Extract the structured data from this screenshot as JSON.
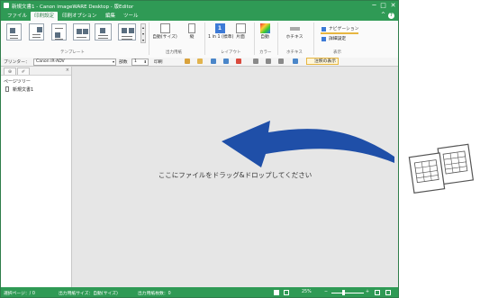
{
  "window": {
    "title": "新規文書1 - Canon imageWARE Desktop - 版Editor",
    "min": "─",
    "max": "□",
    "close": "✕"
  },
  "menubar": {
    "items": [
      {
        "label": "ファイル",
        "active": false
      },
      {
        "label": "印刷設定",
        "active": true
      },
      {
        "label": "印刷オプション",
        "active": false
      },
      {
        "label": "編集",
        "active": false
      },
      {
        "label": "ツール",
        "active": false
      }
    ],
    "help": "?",
    "collapse": "^"
  },
  "ribbon": {
    "groups": {
      "template": "テンプレート",
      "output": "出力用紙",
      "layout": "レイアウト",
      "color": "カラー",
      "stamp": "ホチキス",
      "display": "表示"
    },
    "buttons": {
      "auto_size": "自動(サイズ)",
      "orientation": "縦",
      "n_up": "1 in 1 (標準)",
      "sides": "片面",
      "color": "自動",
      "staple": "ホチキス",
      "navigation": "ナビゲーション",
      "details": "詳細設定"
    }
  },
  "toolbar": {
    "printer_label": "プリンター：",
    "printer_value": "Canon iR-ADV",
    "copies_label": "部数",
    "copies_value": "1",
    "print_label": "印刷",
    "show_options": "注釈の表示"
  },
  "leftpanel": {
    "tabs": [
      "⊕",
      "✐"
    ],
    "close": "×",
    "heading": "ページツリー",
    "document": "新規文書1"
  },
  "work": {
    "drop_hint": "ここにファイルをドラッグ&ドロップしてください"
  },
  "status": {
    "selected_pages": "選択ページ：/ 0",
    "output_size": "出力用紙サイズ：自動(サイズ)",
    "output_count": "出力用紙枚数：0",
    "zoom": "25%",
    "zoom_minus": "−",
    "zoom_plus": "+"
  },
  "colors": {
    "accent": "#2f9a55",
    "arrow": "#1f4fa8",
    "highlight": "#e7b640"
  }
}
